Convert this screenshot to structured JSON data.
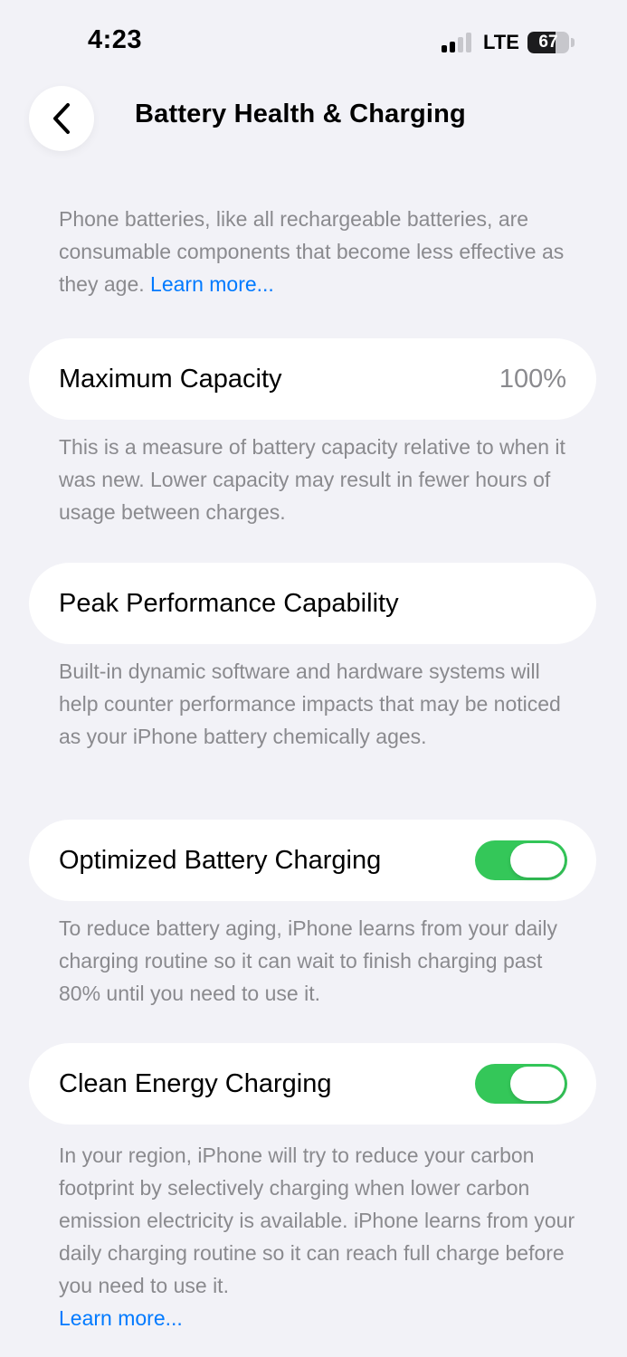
{
  "status_bar": {
    "time": "4:23",
    "network": "LTE",
    "battery_level": "67",
    "battery_fraction": 0.67
  },
  "header": {
    "back_icon": "chevron-left-icon",
    "title": "Battery Health & Charging"
  },
  "intro": {
    "text": "Phone batteries, like all rechargeable batteries, are consumable components that become less effective as they age.",
    "link": "Learn more..."
  },
  "maximum_capacity": {
    "label": "Maximum Capacity",
    "value": "100%",
    "description": "This is a measure of battery capacity relative to when it was new. Lower capacity may result in fewer hours of usage between charges."
  },
  "peak_performance": {
    "label": "Peak Performance Capability",
    "description": "Built-in dynamic software and hardware systems will help counter performance impacts that may be noticed as your iPhone battery chemically ages."
  },
  "optimized_charging": {
    "label": "Optimized Battery Charging",
    "enabled": true,
    "description": "To reduce battery aging, iPhone learns from your daily charging routine so it can wait to finish charging past 80% until you need to use it."
  },
  "clean_energy": {
    "label": "Clean Energy Charging",
    "enabled": true,
    "description": "In your region, iPhone will try to reduce your carbon footprint by selectively charging when lower carbon emission electricity is available. iPhone learns from your daily charging routine so it can reach full charge before you need to use it.",
    "link": "Learn more..."
  },
  "colors": {
    "background": "#f2f2f7",
    "card": "#ffffff",
    "secondary_text": "#8a8a8e",
    "link": "#007aff",
    "toggle_on": "#34c759"
  }
}
